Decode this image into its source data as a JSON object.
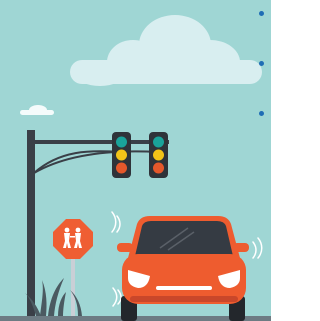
{
  "scene": {
    "colors": {
      "sky": "#9fd6d4",
      "cloud": "#d8eef0",
      "cloud_small": "#f4fbfb",
      "pole": "#3a3f47",
      "pole_dark": "#2b2f35",
      "traffic_light_body": "#2f3339",
      "light_green": "#1aa39a",
      "light_yellow": "#f2c318",
      "light_red": "#e5582b",
      "sign_orange": "#ef5e33",
      "sign_text": "#ffffff",
      "sign_post": "#c9cfd6",
      "car_body": "#ee5c2f",
      "car_dark": "#c9472a",
      "car_window": "#353b43",
      "car_light": "#ffffff",
      "tire": "#23272c",
      "grass": "#4b5a61",
      "road": "#6d7b83",
      "motion_lines": "#ffffff",
      "bullet": "#1f6db5"
    },
    "icons": [
      "cloud-icon",
      "traffic-light-icon",
      "school-crossing-sign-icon",
      "car-icon",
      "grass-icon"
    ],
    "bullets": 3
  }
}
